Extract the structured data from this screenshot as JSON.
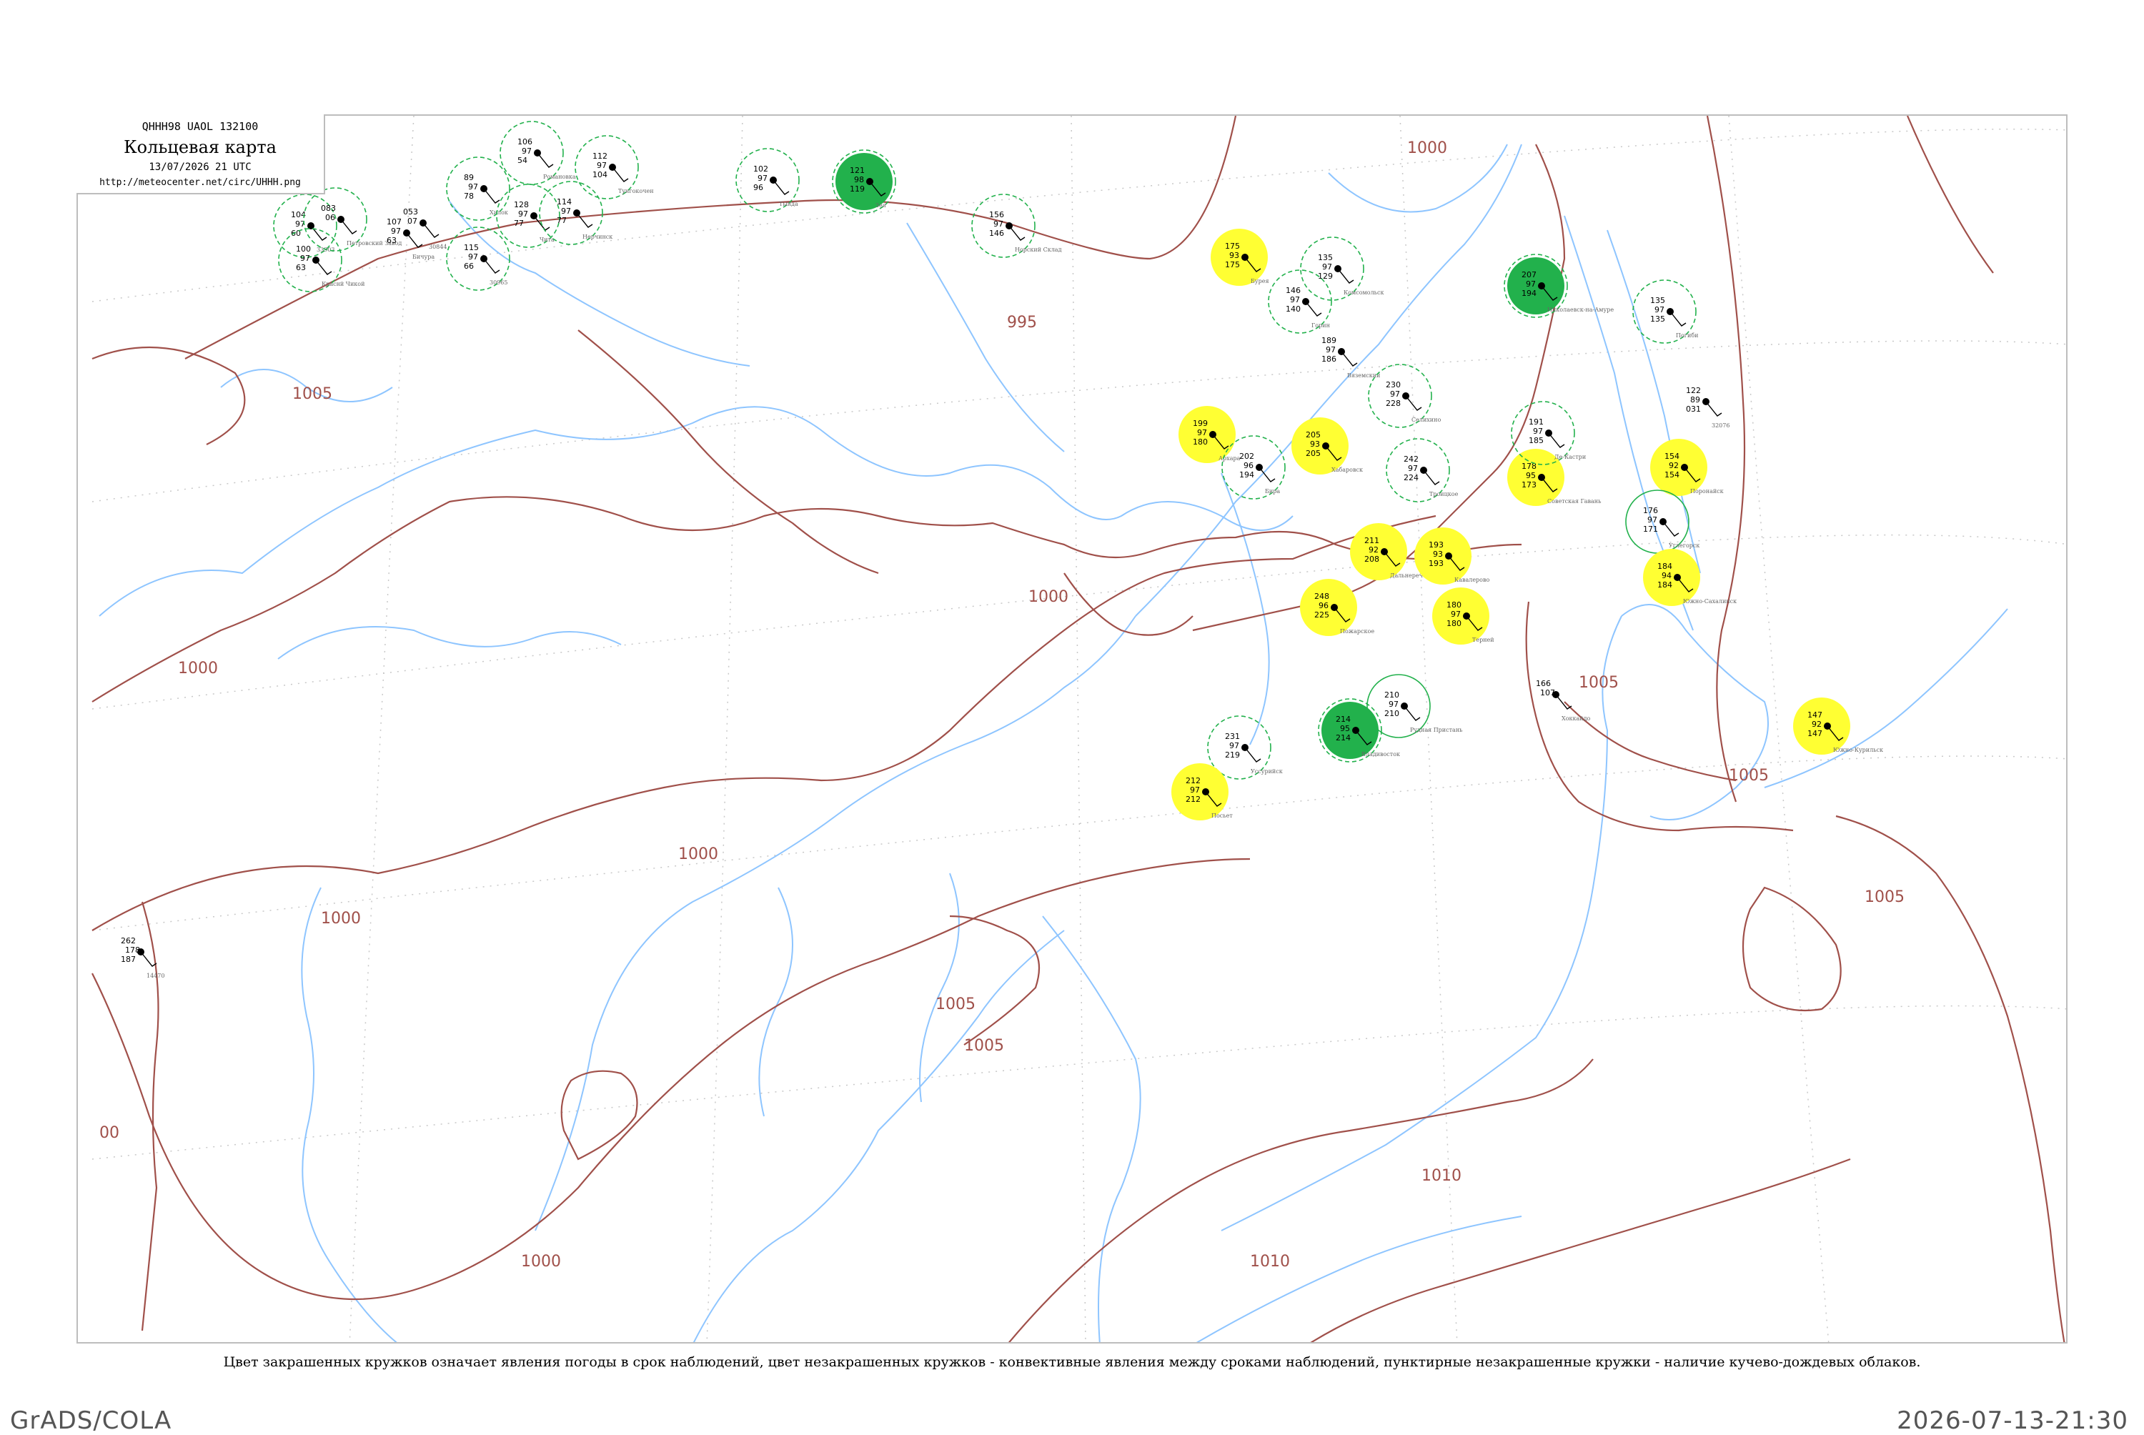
{
  "title": {
    "code": "QHHH98  UAOL  132100",
    "main": "Кольцевая карта",
    "date": "13/07/2026 21 UTC",
    "url": "http://meteocenter.net/circ/UHHH.png"
  },
  "caption": "Цвет закрашенных кружков означает явления погоды в срок наблюдений, цвет незакрашенных кружков - конвективные явления между сроками наблюдений, пунктирные незакрашенные кружки - наличие кучево-дождевых облаков.",
  "footer": {
    "left": "GrADS/COLA",
    "right": "2026-07-13-21:30"
  },
  "colors": {
    "isobar": "#a0504a",
    "coast": "#8ec5ff",
    "fill_green": "#22b14c",
    "fill_yellow": "#ffff33",
    "ring_green": "#22b14c"
  },
  "isobar_labels": [
    {
      "text": "1005"
    },
    {
      "text": "1000"
    },
    {
      "text": "995"
    },
    {
      "text": "1000"
    },
    {
      "text": "1000"
    },
    {
      "text": "1000"
    },
    {
      "text": "1005"
    },
    {
      "text": "1000"
    },
    {
      "text": "00"
    },
    {
      "text": "1005"
    },
    {
      "text": "1010"
    },
    {
      "text": "1010"
    },
    {
      "text": "1005"
    },
    {
      "text": "1005"
    },
    {
      "text": "1005"
    },
    {
      "text": "1000"
    }
  ],
  "stations": [
    {
      "values": [
        "104",
        "97",
        "60"
      ],
      "name": "33903",
      "ring": "dashed",
      "fill": "none"
    },
    {
      "values": [
        "100",
        "97",
        "63"
      ],
      "name": "Краснй Чикой",
      "ring": "dashed",
      "fill": "none"
    },
    {
      "values": [
        "083",
        "06"
      ],
      "name": "Петровский Завод",
      "ring": "dashed",
      "fill": "none"
    },
    {
      "values": [
        "107",
        "97",
        "63"
      ],
      "name": "Бичура",
      "ring": "none",
      "fill": "none"
    },
    {
      "values": [
        "053",
        "07"
      ],
      "name": "30844",
      "ring": "none",
      "fill": "none"
    },
    {
      "values": [
        "89",
        "97",
        "78"
      ],
      "name": "Хилок",
      "ring": "dashed",
      "fill": "none"
    },
    {
      "values": [
        "106",
        "97",
        "54"
      ],
      "name": "Романовка",
      "ring": "dashed",
      "fill": "none"
    },
    {
      "values": [
        "128",
        "97",
        "77"
      ],
      "name": "Чита",
      "ring": "dashed",
      "fill": "none"
    },
    {
      "values": [
        "115",
        "97",
        "66"
      ],
      "name": "30965",
      "ring": "dashed",
      "fill": "none"
    },
    {
      "values": [
        "114",
        "97",
        "77"
      ],
      "name": "Нерчинск",
      "ring": "dashed",
      "fill": "none"
    },
    {
      "values": [
        "112",
        "97",
        "104"
      ],
      "name": "Тунгокочен",
      "ring": "dashed",
      "fill": "none"
    },
    {
      "values": [
        "102",
        "97",
        "96"
      ],
      "name": "Тында",
      "ring": "dashed",
      "fill": "none"
    },
    {
      "values": [
        "121",
        "98",
        "119"
      ],
      "name": "Зея",
      "ring": "dashed",
      "fill": "green"
    },
    {
      "values": [
        "156",
        "97",
        "146"
      ],
      "name": "Норский Склад",
      "ring": "dashed",
      "fill": "none"
    },
    {
      "values": [
        "175",
        "93",
        "175"
      ],
      "name": "Бурея",
      "ring": "none",
      "fill": "yellow"
    },
    {
      "values": [
        "199",
        "97",
        "180"
      ],
      "name": "Архара",
      "ring": "none",
      "fill": "yellow"
    },
    {
      "values": [
        "202",
        "96",
        "194"
      ],
      "name": "Бира",
      "ring": "dashed",
      "fill": "none"
    },
    {
      "values": [
        "205",
        "93",
        "205"
      ],
      "name": "Хабаровск",
      "ring": "none",
      "fill": "yellow"
    },
    {
      "values": [
        "135",
        "97",
        "129"
      ],
      "name": "Комсомольск",
      "ring": "dashed",
      "fill": "none"
    },
    {
      "values": [
        "146",
        "97",
        "140"
      ],
      "name": "Горин",
      "ring": "dashed",
      "fill": "none"
    },
    {
      "values": [
        "189",
        "97",
        "186"
      ],
      "name": "Вяземский",
      "ring": "none",
      "fill": "none"
    },
    {
      "values": [
        "242",
        "97",
        "224"
      ],
      "name": "Троицкое",
      "ring": "dashed",
      "fill": "none"
    },
    {
      "values": [
        "230",
        "97",
        "228"
      ],
      "name": "Селихино",
      "ring": "dashed",
      "fill": "none"
    },
    {
      "values": [
        "211",
        "92",
        "208"
      ],
      "name": "Дальнереченск",
      "ring": "none",
      "fill": "yellow"
    },
    {
      "values": [
        "193",
        "93",
        "193"
      ],
      "name": "Кавалерово",
      "ring": "none",
      "fill": "yellow"
    },
    {
      "values": [
        "180",
        "97",
        "180"
      ],
      "name": "Терней",
      "ring": "none",
      "fill": "yellow"
    },
    {
      "values": [
        "248",
        "96",
        "225"
      ],
      "name": "Пожарское",
      "ring": "none",
      "fill": "yellow"
    },
    {
      "values": [
        "210",
        "97",
        "210"
      ],
      "name": "Рудная Пристань",
      "ring": "solid",
      "fill": "none"
    },
    {
      "values": [
        "214",
        "95",
        "214"
      ],
      "name": "Владивосток",
      "ring": "dashed",
      "fill": "green"
    },
    {
      "values": [
        "231",
        "97",
        "219"
      ],
      "name": "Уссурийск",
      "ring": "dashed",
      "fill": "none"
    },
    {
      "values": [
        "212",
        "97",
        "212"
      ],
      "name": "Посьет",
      "ring": "none",
      "fill": "yellow"
    },
    {
      "values": [
        "178",
        "95",
        "173"
      ],
      "name": "Советская Гавань",
      "ring": "none",
      "fill": "yellow"
    },
    {
      "values": [
        "191",
        "97",
        "185"
      ],
      "name": "Де-Кастри",
      "ring": "dashed",
      "fill": "none"
    },
    {
      "values": [
        "207",
        "97",
        "194"
      ],
      "name": "Николаевск-на-Амуре",
      "ring": "dashed",
      "fill": "green"
    },
    {
      "values": [
        "135",
        "97",
        "135"
      ],
      "name": "Погиби",
      "ring": "dashed",
      "fill": "none"
    },
    {
      "values": [
        "154",
        "92",
        "154"
      ],
      "name": "Поронайск",
      "ring": "none",
      "fill": "yellow"
    },
    {
      "values": [
        "176",
        "97",
        "171"
      ],
      "name": "Углегорск",
      "ring": "solid",
      "fill": "none"
    },
    {
      "values": [
        "184",
        "94",
        "184"
      ],
      "name": "Южно-Сахалинск",
      "ring": "none",
      "fill": "yellow"
    },
    {
      "values": [
        "147",
        "92",
        "147"
      ],
      "name": "Южно-Курильск",
      "ring": "none",
      "fill": "yellow"
    },
    {
      "values": [
        "166",
        "107"
      ],
      "name": "Хоккайдо",
      "ring": "none",
      "fill": "none"
    },
    {
      "values": [
        "262",
        "178",
        "187"
      ],
      "name": "14470",
      "ring": "none",
      "fill": "none"
    },
    {
      "values": [
        "122",
        "89",
        "031"
      ],
      "name": "32076",
      "ring": "none",
      "fill": "none"
    }
  ]
}
